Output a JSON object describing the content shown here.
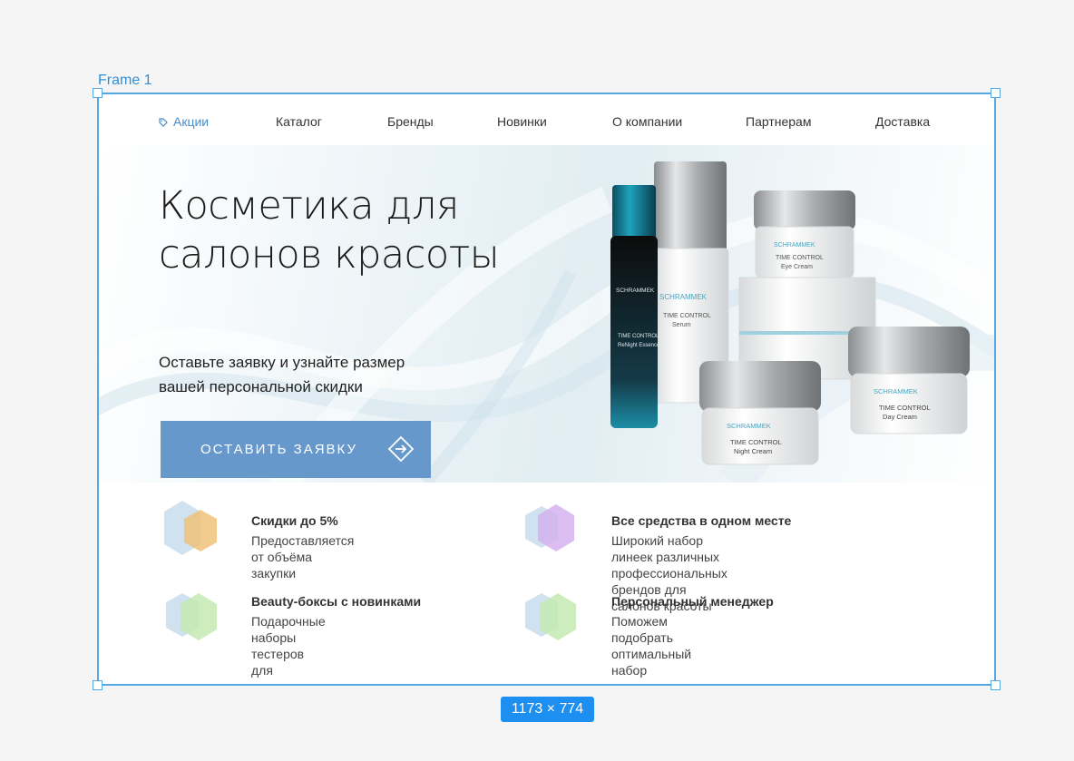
{
  "frame": {
    "label": "Frame 1",
    "size_label": "1173 × 774"
  },
  "nav": {
    "items": [
      {
        "label": "Акции",
        "active": true
      },
      {
        "label": "Каталог"
      },
      {
        "label": "Бренды"
      },
      {
        "label": "Новинки"
      },
      {
        "label": "О компании"
      },
      {
        "label": "Партнерам"
      },
      {
        "label": "Доставка"
      }
    ]
  },
  "hero": {
    "title": "Косметика для\nсалонов красоты",
    "subtitle": "Оставьте заявку и узнайте размер\nвашей  персональной скидки",
    "cta_label": "ОСТАВИТЬ ЗАЯВКУ"
  },
  "products": {
    "brand": "SCHRAMMEK",
    "items": [
      {
        "name": "TIME CONTROL\nRefNight Essence"
      },
      {
        "name": "TIME CONTROL\nSerum"
      },
      {
        "name": "TIME CONTROL\nEye Cream"
      },
      {
        "name": "TIME CONTROL\nNight Cream"
      },
      {
        "name": "TIME CONTROL\nDay Cream"
      }
    ]
  },
  "features": [
    {
      "title": "Скидки до 5%",
      "desc": "Предоставляется от объёма закупки",
      "accent": "#f0c27a"
    },
    {
      "title": "Все средства в одном месте",
      "desc": "Широкий набор линеек различных\nпрофессиональных брендов для салонов красоты",
      "accent": "#d5b1ee"
    },
    {
      "title": "Beauty-боксы с новинками",
      "desc": "Подарочные наборы тестеров\nдля партнеров",
      "accent": "#c4eab3"
    },
    {
      "title": "Персональный менеджер",
      "desc": "Поможем подобрать\nоптимальный набор продуктов",
      "accent": "#c4eab3"
    }
  ],
  "colors": {
    "accent": "#6698cb",
    "selection": "#56a8e2",
    "hex_base": "#c8dcec"
  },
  "icons": {
    "tag": "tag-icon",
    "arrow": "arrow-right-diamond-icon"
  }
}
